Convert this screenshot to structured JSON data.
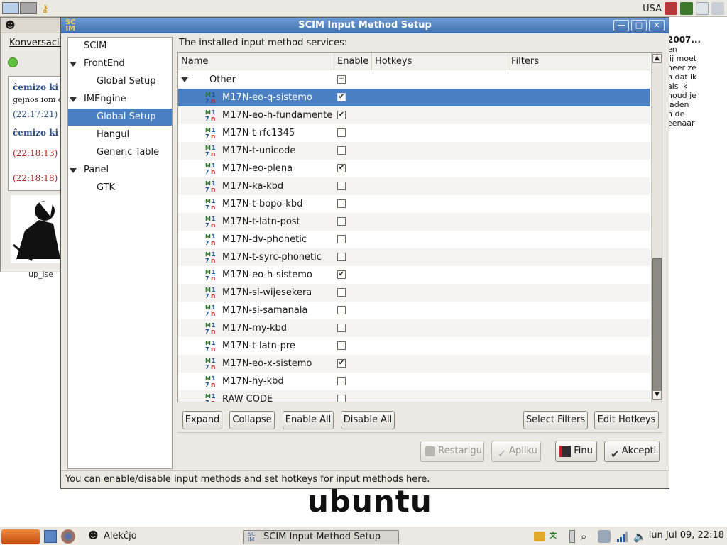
{
  "top_panel": {
    "keyboard_label": "USA",
    "icons": [
      "workspace-1",
      "workspace-2",
      "keys-icon",
      "network-icon",
      "system-monitor-icon",
      "paper-icon"
    ]
  },
  "chat_window": {
    "menu": "Konversacio",
    "lines": [
      {
        "text": "ĉemizo ki",
        "color": "#2a4f8a"
      },
      {
        "text": "gejnos iom d",
        "color": "#111111"
      },
      {
        "text": "(22:17:21)",
        "color": "#2a4f8a"
      },
      {
        "text": "ĉemizo ki",
        "color": "#2a4f8a"
      },
      {
        "text": "(22:18:13)",
        "color": "#b22222"
      },
      {
        "text": "(22:18:18)",
        "color": "#b22222"
      }
    ],
    "below": "up_ise"
  },
  "right_background_text": [
    "2007...",
    "en",
    "jij moet",
    "neer ze",
    "h dat ik",
    "als ik",
    "",
    "houd je",
    "laden",
    "n de",
    "eenaar"
  ],
  "dialog": {
    "title": "SCIM Input Method Setup",
    "sidebar": [
      {
        "label": "SCIM",
        "level": 0,
        "expander": false,
        "selected": false
      },
      {
        "label": "FrontEnd",
        "level": 0,
        "expander": true,
        "selected": false
      },
      {
        "label": "Global Setup",
        "level": 1,
        "expander": false,
        "selected": false
      },
      {
        "label": "IMEngine",
        "level": 0,
        "expander": true,
        "selected": false
      },
      {
        "label": "Global Setup",
        "level": 1,
        "expander": false,
        "selected": true
      },
      {
        "label": "Hangul",
        "level": 1,
        "expander": false,
        "selected": false
      },
      {
        "label": "Generic Table",
        "level": 1,
        "expander": false,
        "selected": false
      },
      {
        "label": "Panel",
        "level": 0,
        "expander": true,
        "selected": false
      },
      {
        "label": "GTK",
        "level": 1,
        "expander": false,
        "selected": false
      }
    ],
    "installed_label": "The installed input method services:",
    "columns": {
      "name": "Name",
      "enable": "Enable",
      "hotkeys": "Hotkeys",
      "filters": "Filters"
    },
    "group": {
      "label": "Other",
      "enabled": "mixed"
    },
    "rows": [
      {
        "name": "M17N-eo-q-sistemo",
        "enabled": true,
        "selected": true
      },
      {
        "name": "M17N-eo-h-fundamente",
        "enabled": true
      },
      {
        "name": "M17N-t-rfc1345",
        "enabled": false
      },
      {
        "name": "M17N-t-unicode",
        "enabled": false
      },
      {
        "name": "M17N-eo-plena",
        "enabled": true
      },
      {
        "name": "M17N-ka-kbd",
        "enabled": false
      },
      {
        "name": "M17N-t-bopo-kbd",
        "enabled": false
      },
      {
        "name": "M17N-t-latn-post",
        "enabled": false
      },
      {
        "name": "M17N-dv-phonetic",
        "enabled": false
      },
      {
        "name": "M17N-t-syrc-phonetic",
        "enabled": false
      },
      {
        "name": "M17N-eo-h-sistemo",
        "enabled": true
      },
      {
        "name": "M17N-si-wijesekera",
        "enabled": false
      },
      {
        "name": "M17N-si-samanala",
        "enabled": false
      },
      {
        "name": "M17N-my-kbd",
        "enabled": false
      },
      {
        "name": "M17N-t-latn-pre",
        "enabled": false
      },
      {
        "name": "M17N-eo-x-sistemo",
        "enabled": true
      },
      {
        "name": "M17N-hy-kbd",
        "enabled": false
      },
      {
        "name": "RAW CODE",
        "enabled": false
      }
    ],
    "buttons": {
      "expand": "Expand",
      "collapse": "Collapse",
      "enable_all": "Enable All",
      "disable_all": "Disable All",
      "select_filters": "Select Filters",
      "edit_hotkeys": "Edit Hotkeys",
      "reset": "Restarigu",
      "apply": "Apliku",
      "close": "Finu",
      "ok": "Akcepti"
    },
    "status": "You can enable/disable input methods and set hotkeys for input methods here."
  },
  "desktop": {
    "logo_text": "ubuntu"
  },
  "bottom_panel": {
    "user": "Alekĉjo",
    "task": "SCIM Input Method Setup",
    "clock": "lun Jul 09, 22:18"
  },
  "colors": {
    "accent": "#4a7fc2",
    "title_top": "#6f9bd2",
    "title_bottom": "#3f6fb0"
  }
}
